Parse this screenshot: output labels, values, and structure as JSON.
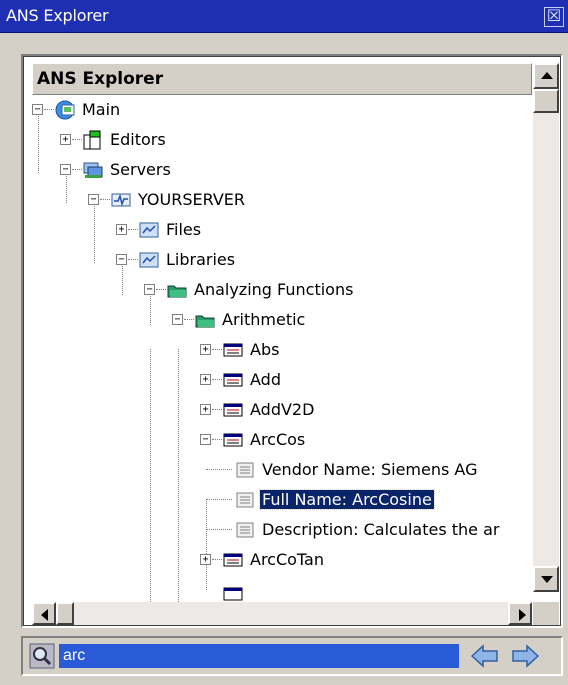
{
  "window": {
    "title": "ANS Explorer",
    "close_glyph": "☒"
  },
  "tree": {
    "header": "ANS Explorer",
    "nodes": [
      {
        "label": "Main",
        "icon": "main-icon",
        "expander": "−"
      },
      {
        "label": "Editors",
        "icon": "editors-icon",
        "expander": "+"
      },
      {
        "label": "Servers",
        "icon": "servers-icon",
        "expander": "−"
      },
      {
        "label": "YOURSERVER",
        "icon": "server-icon",
        "expander": "−"
      },
      {
        "label": "Files",
        "icon": "files-icon",
        "expander": "+"
      },
      {
        "label": "Libraries",
        "icon": "libraries-icon",
        "expander": "−"
      },
      {
        "label": "Analyzing Functions",
        "icon": "folder-icon",
        "expander": "−"
      },
      {
        "label": "Arithmetic",
        "icon": "folder-icon",
        "expander": "−"
      },
      {
        "label": "Abs",
        "icon": "function-icon",
        "expander": "+"
      },
      {
        "label": "Add",
        "icon": "function-icon",
        "expander": "+"
      },
      {
        "label": "AddV2D",
        "icon": "function-icon",
        "expander": "+"
      },
      {
        "label": "ArcCos",
        "icon": "function-icon",
        "expander": "−"
      },
      {
        "label": "Vendor Name: Siemens AG",
        "icon": "property-icon"
      },
      {
        "label": "Full Name: ArcCosine",
        "icon": "property-icon",
        "selected": true
      },
      {
        "label": "Description: Calculates the ar",
        "icon": "property-icon"
      },
      {
        "label": "ArcCoTan",
        "icon": "function-icon",
        "expander": "+"
      }
    ]
  },
  "search": {
    "value": "arc"
  },
  "colors": {
    "titlebar": "#1f2fb3",
    "selection": "#0a246a",
    "search_bg": "#2a5bd6"
  }
}
